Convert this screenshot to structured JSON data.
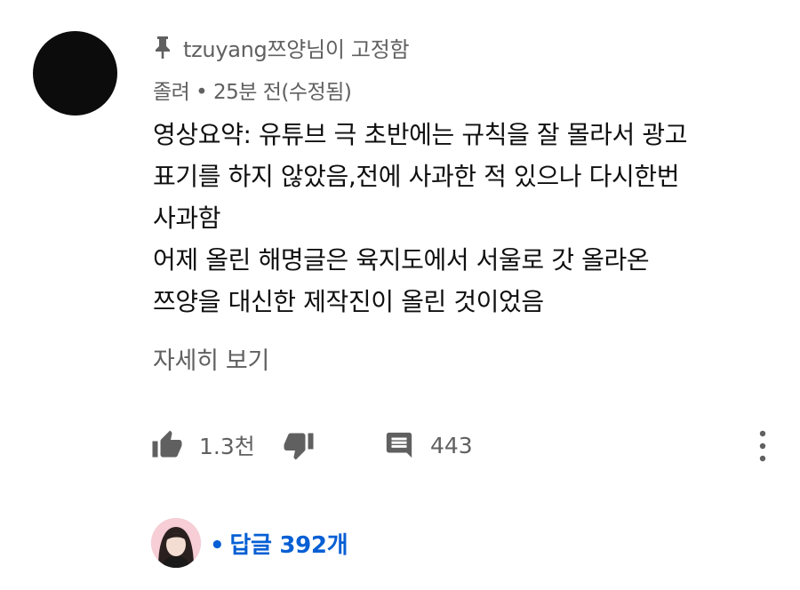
{
  "comment": {
    "pinned_text": "tzuyang쯔양님이 고정함",
    "author": "졸려",
    "separator": "•",
    "time": "25분 전(수정됨)",
    "body_lines": [
      "영상요약: 유튜브 극 초반에는 규칙을 잘 몰라서 광고",
      "표기를 하지 않았음,전에 사과한 적 있으나 다시한번",
      "사과함",
      "어제 올린 해명글은 육지도에서 서울로 갓 올라온",
      "쯔양을 대신한 제작진이 올린 것이었음"
    ],
    "read_more": "자세히 보기",
    "like_count": "1.3천",
    "reply_count": "443",
    "replies_label": "답글 392개",
    "replies_dot": "•"
  },
  "icons": {
    "pin": "pin-icon",
    "like": "thumb-up-icon",
    "dislike": "thumb-down-icon",
    "reply": "comment-icon",
    "more": "more-vertical-icon"
  },
  "colors": {
    "secondary_text": "#606060",
    "link_blue": "#065fd4",
    "avatar": "#0c0c0c",
    "icon_gray": "#606060"
  }
}
